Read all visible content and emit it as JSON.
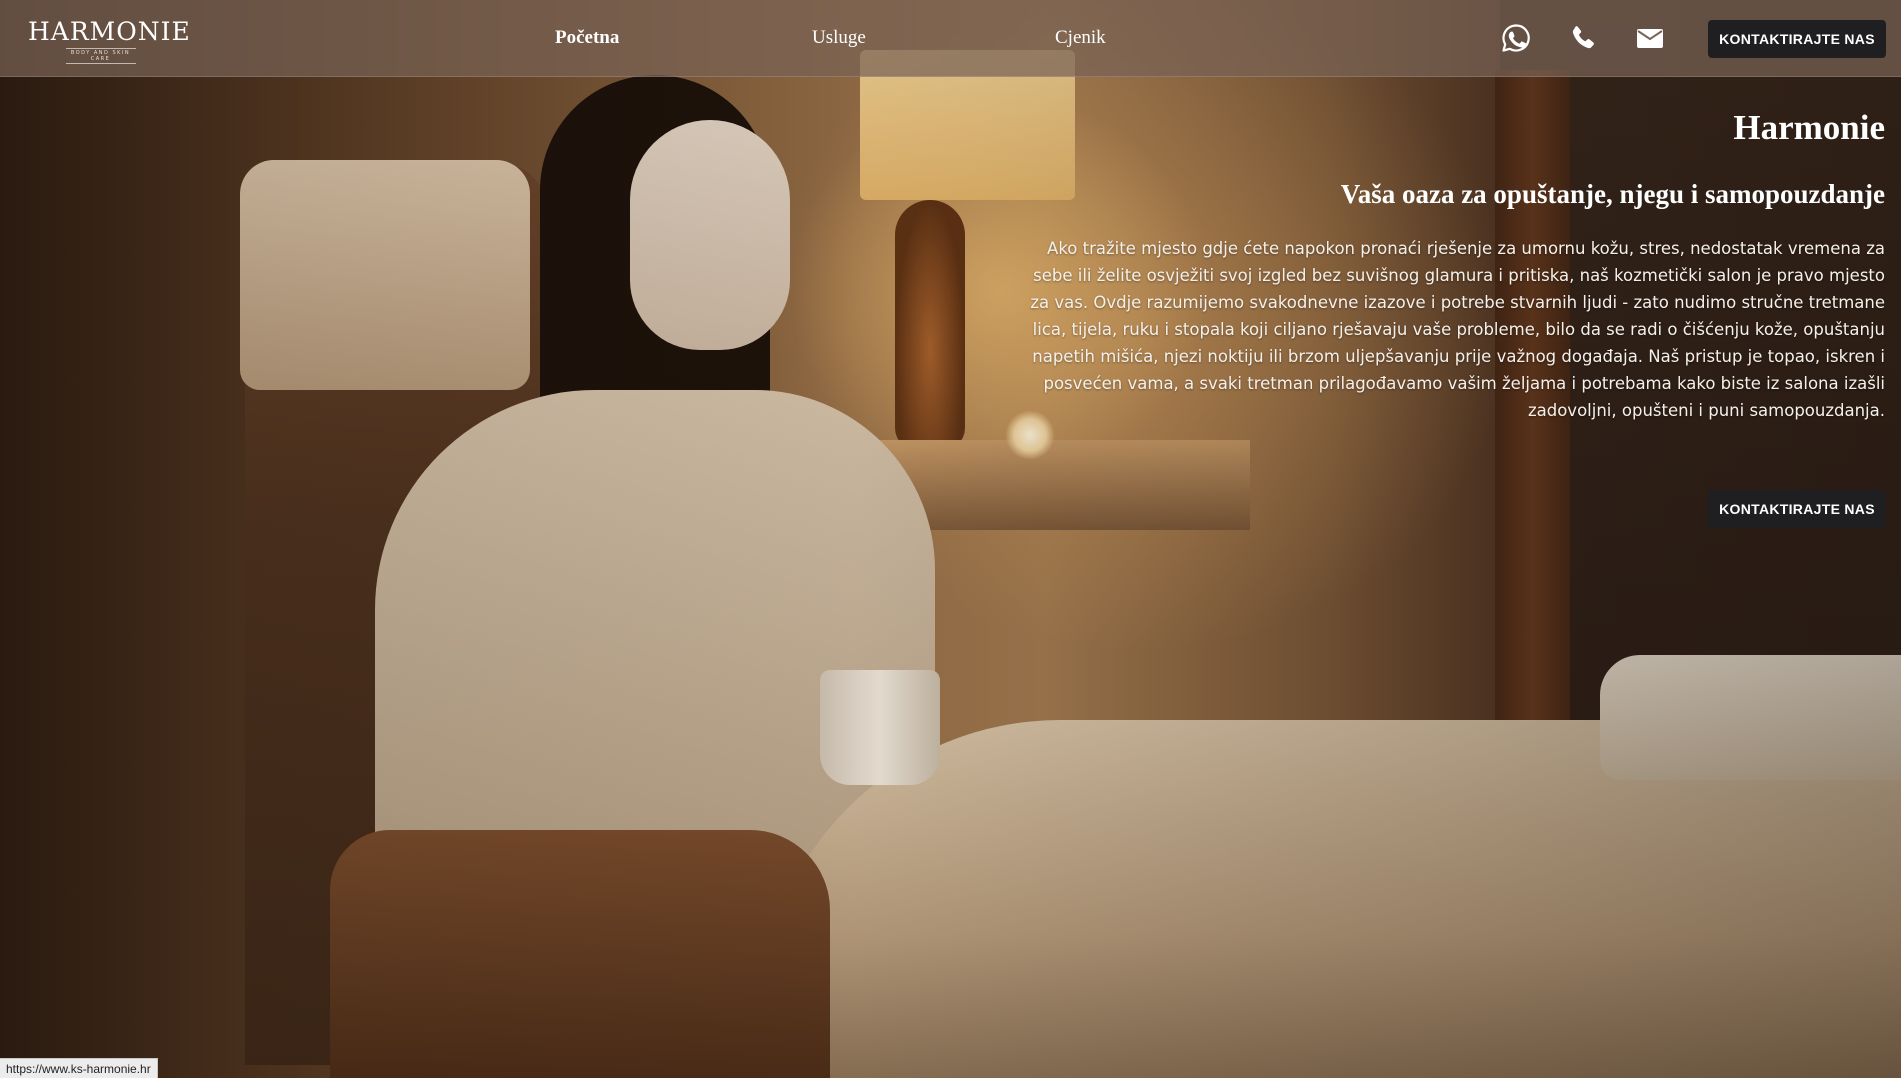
{
  "nav": {
    "logo_text": "HARMONIE",
    "logo_tagline": "BODY AND SKIN CARE",
    "links": [
      {
        "label": "Početna",
        "active": true
      },
      {
        "label": "Usluge",
        "active": false
      },
      {
        "label": "Cjenik",
        "active": false
      }
    ],
    "icons": [
      "whatsapp-icon",
      "phone-icon",
      "email-icon"
    ],
    "cta_label": "KONTAKTIRAJTE NAS"
  },
  "hero": {
    "title": "Harmonie",
    "subtitle": "Vaša oaza za opuštanje, njegu i samopouzdanje",
    "paragraph": "Ako tražite mjesto gdje ćete napokon pronaći rješenje za umornu kožu, stres, nedostatak vremena za sebe ili želite osvježiti svoj izgled bez suvišnog glamura i pritiska, naš kozmetički salon je pravo mjesto za vas. Ovdje razumijemo svakodnevne izazove i potrebe stvarnih ljudi - zato nudimo stručne tretmane lica, tijela, ruku i stopala koji ciljano rješavaju vaše probleme, bilo da se radi o čišćenju kože, opuštanju napetih mišića, njezi noktiju ili brzom uljepšavanju prije važnog događaja. Naš pristup je topao, iskren i posvećen vama, a svaki tretman prilagođavamo vašim željama i potrebama kako biste iz salona izašli zadovoljni, opušteni i puni samopouzdanja.",
    "cta_label": "KONTAKTIRAJTE NAS"
  },
  "status_bar": {
    "url": "https://www.ks-harmonie.hr"
  },
  "colors": {
    "nav_background": "#786254",
    "button_background": "#1f1f21",
    "text": "#ffffff"
  }
}
